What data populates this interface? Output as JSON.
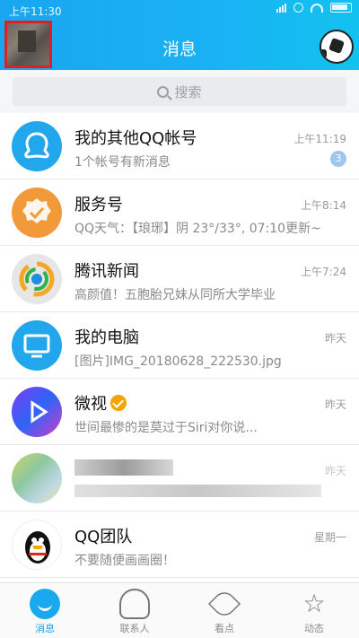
{
  "status_bar": {
    "time": "上午11:30"
  },
  "header": {
    "title": "消息"
  },
  "search": {
    "placeholder": "搜索"
  },
  "conversations": [
    {
      "name": "我的其他QQ帐号",
      "preview": "1个帐号有新消息",
      "time": "上午11:19",
      "badge": "3",
      "avatar": "multi-account-icon"
    },
    {
      "name": "服务号",
      "preview": "QQ天气：【琅琊】阴 23°/33°, 07:10更新~",
      "time": "上午8:14",
      "avatar": "service-badge-icon"
    },
    {
      "name": "腾讯新闻",
      "preview": "高颜值！五胞胎兄妹从同所大学毕业",
      "time": "上午7:24",
      "avatar": "tencent-news-logo"
    },
    {
      "name": "我的电脑",
      "preview": "[图片]IMG_20180628_222530.jpg",
      "time": "昨天",
      "avatar": "monitor-icon"
    },
    {
      "name": "微视",
      "preview": "世间最惨的是莫过于Siri对你说...",
      "time": "昨天",
      "verified": true,
      "avatar": "weishi-logo"
    },
    {
      "name": "",
      "preview": "",
      "time": "昨天",
      "blurred": true,
      "avatar": "blurred-avatar"
    },
    {
      "name": "QQ团队",
      "preview": "不要随便画画圈！",
      "time": "星期一",
      "avatar": "penguin-icon"
    }
  ],
  "tabbar": {
    "tabs": [
      {
        "label": "消息",
        "icon": "chat-bubble-icon",
        "active": true
      },
      {
        "label": "联系人",
        "icon": "contact-icon"
      },
      {
        "label": "看点",
        "icon": "eye-icon"
      },
      {
        "label": "动态",
        "icon": "star-icon"
      }
    ]
  },
  "colors": {
    "accent": "#1aa8ef",
    "badge": "#9fc7ec",
    "highlight_box": "#e02020"
  }
}
